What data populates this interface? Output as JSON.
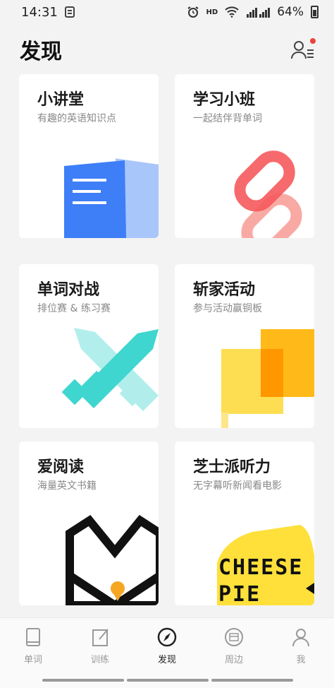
{
  "status_bar": {
    "time": "14:31",
    "hd": "HD",
    "battery": "64%"
  },
  "header": {
    "title": "发现"
  },
  "cards": [
    {
      "title": "小讲堂",
      "subtitle": "有趣的英语知识点",
      "art": "document-icon"
    },
    {
      "title": "学习小班",
      "subtitle": "一起结伴背单词",
      "art": "chain-link-icon"
    },
    {
      "title": "单词对战",
      "subtitle": "排位赛 & 练习赛",
      "art": "crossed-swords-icon"
    },
    {
      "title": "斩家活动",
      "subtitle": "参与活动赢铜板",
      "art": "flag-icon"
    },
    {
      "title": "爱阅读",
      "subtitle": "海量英文书籍",
      "art": "open-book-icon"
    },
    {
      "title": "芝士派听力",
      "subtitle": "无字幕听新闻看电影",
      "art": "cheese-pie-logo",
      "logo_text": "CHEESE PIE"
    }
  ],
  "bottom_nav": [
    {
      "label": "单词",
      "icon": "book-icon",
      "active": false
    },
    {
      "label": "训练",
      "icon": "edit-icon",
      "active": false
    },
    {
      "label": "发现",
      "icon": "compass-icon",
      "active": true
    },
    {
      "label": "周边",
      "icon": "shop-icon",
      "active": false
    },
    {
      "label": "我",
      "icon": "person-icon",
      "active": false
    }
  ],
  "colors": {
    "background": "#f3f3f3",
    "card": "#ffffff",
    "blue": "#3e7ef7",
    "red": "#f5595c",
    "teal": "#3fd6cf",
    "yellow": "#fdd835",
    "orange": "#ffb300",
    "notification": "#e9443b"
  }
}
